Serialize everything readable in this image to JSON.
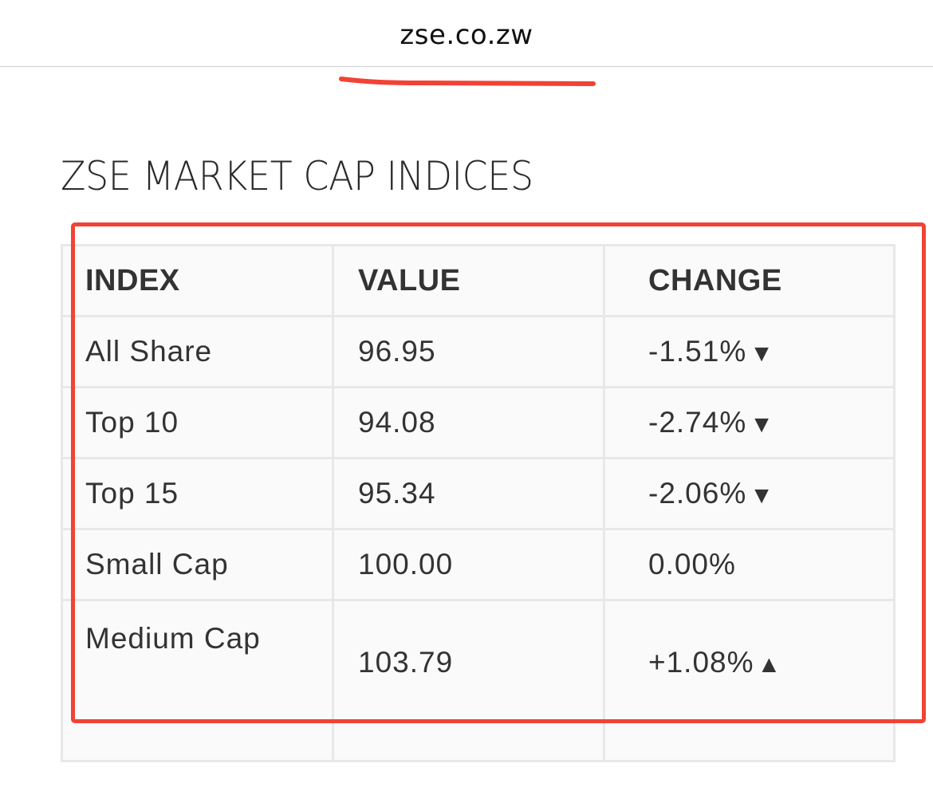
{
  "browser": {
    "url": "zse.co.zw"
  },
  "page": {
    "title": "ZSE MARKET CAP INDICES"
  },
  "table": {
    "headers": [
      "INDEX",
      "VALUE",
      "CHANGE"
    ],
    "rows": [
      {
        "index": "All Share",
        "value": "96.95",
        "change": "-1.51%",
        "arrow": "▼"
      },
      {
        "index": "Top 10",
        "value": "94.08",
        "change": "-2.74%",
        "arrow": "▼"
      },
      {
        "index": "Top 15",
        "value": "95.34",
        "change": "-2.06%",
        "arrow": "▼"
      },
      {
        "index": "Small Cap",
        "value": "100.00",
        "change": "0.00%",
        "arrow": ""
      },
      {
        "index": "Medium Cap",
        "value": "103.79",
        "change": "+1.08%",
        "arrow": "▲"
      }
    ]
  },
  "annotations": {
    "highlight_color": "#f24236"
  }
}
